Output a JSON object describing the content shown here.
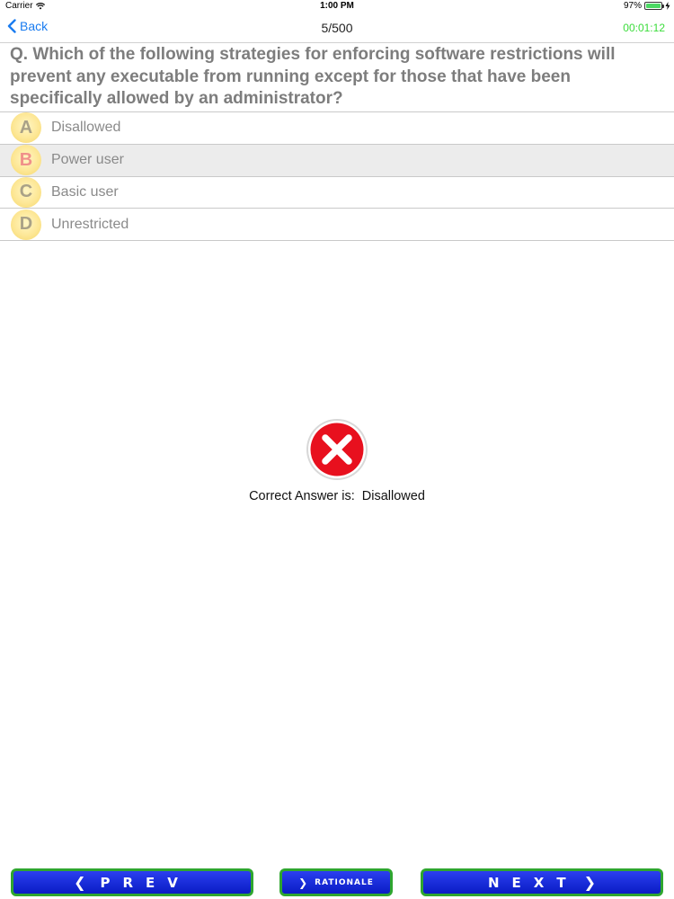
{
  "status_bar": {
    "carrier": "Carrier",
    "time": "1:00 PM",
    "battery": "97%",
    "battery_level": 0.97
  },
  "nav": {
    "back_label": "Back",
    "progress": "5/500",
    "timer": "00:01:12"
  },
  "question": {
    "text": "Q. Which of the following strategies for enforcing software restrictions will prevent any executable from running except for those that have been specifically allowed by an administrator?"
  },
  "options": [
    {
      "letter": "A",
      "label": "Disallowed"
    },
    {
      "letter": "B",
      "label": "Power user"
    },
    {
      "letter": "C",
      "label": "Basic user"
    },
    {
      "letter": "D",
      "label": "Unrestricted"
    }
  ],
  "selected_option": "B",
  "result": {
    "status": "incorrect",
    "icon": "x-circle-icon",
    "text": "Correct Answer is:  Disallowed"
  },
  "buttons": {
    "prev_label": "PREV",
    "rationale_label": "RATIONALE",
    "next_label": "NEXT"
  },
  "colors": {
    "back_link": "#1a7cf0",
    "timer": "#3adc3a",
    "button_fill": "#1a2ee0",
    "button_border": "#2fa62f",
    "error_red": "#e8101e"
  }
}
